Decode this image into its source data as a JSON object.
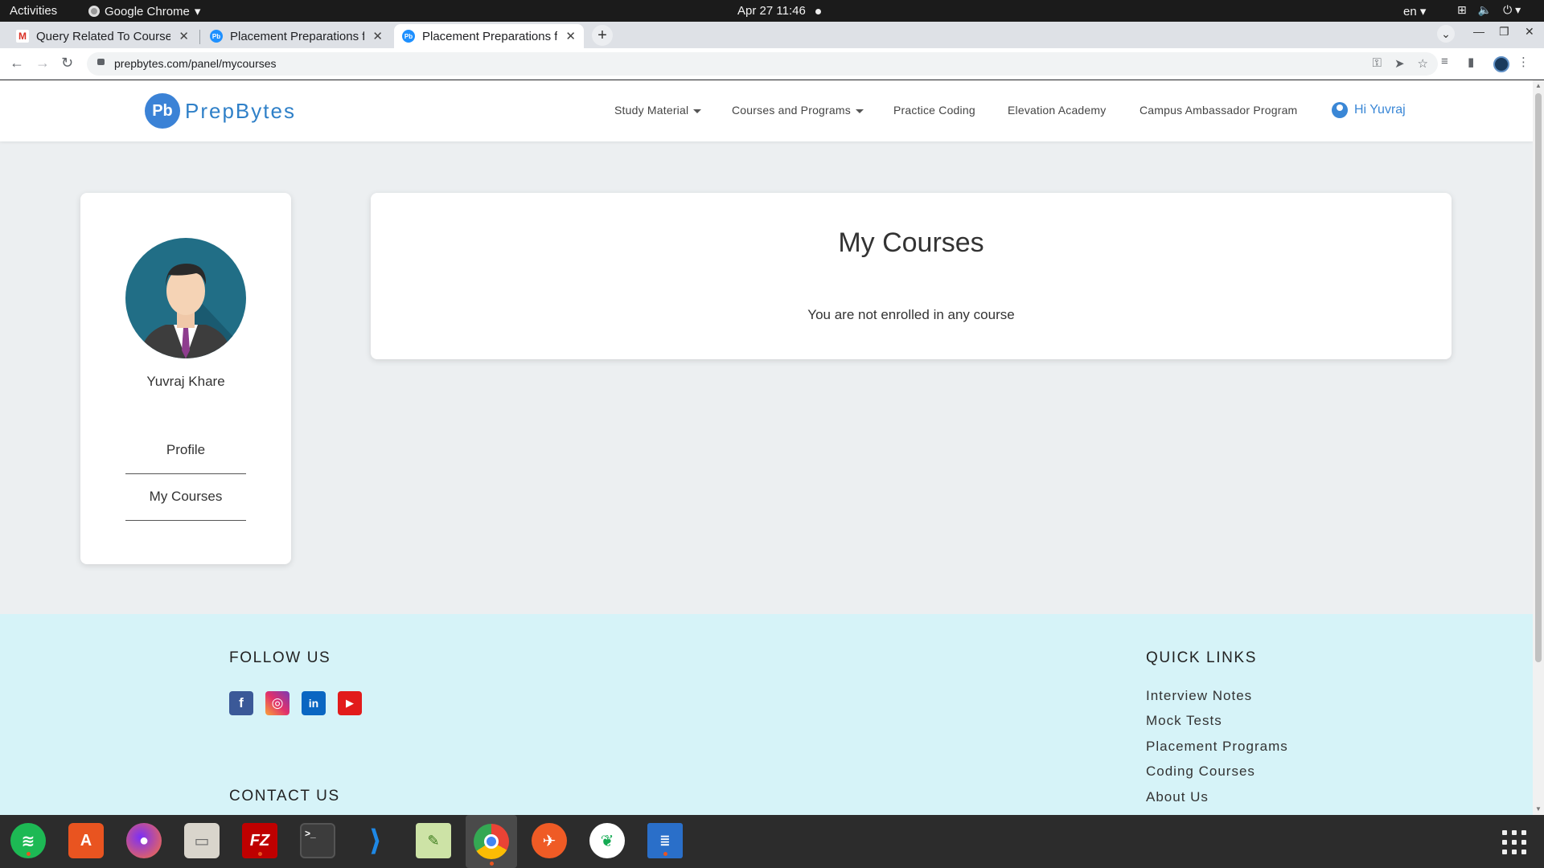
{
  "os": {
    "activities": "Activities",
    "app_name": "Google Chrome",
    "date": "Apr 27",
    "time": "11:46",
    "lang": "en"
  },
  "browser": {
    "tabs": [
      {
        "title": "Query Related To Course",
        "favicon": "gmail-icon",
        "active": false
      },
      {
        "title": "Placement Preparations f",
        "favicon": "prepbytes-icon",
        "active": false
      },
      {
        "title": "Placement Preparations f",
        "favicon": "prepbytes-icon",
        "active": true
      }
    ],
    "url": "prepbytes.com/panel/mycourses"
  },
  "site": {
    "logo_mark": "Pb",
    "logo_text": "PrepBytes",
    "nav": [
      {
        "label": "Study Material",
        "dropdown": true
      },
      {
        "label": "Courses and Programs",
        "dropdown": true
      },
      {
        "label": "Practice Coding",
        "dropdown": false
      },
      {
        "label": "Elevation Academy",
        "dropdown": false
      },
      {
        "label": "Campus Ambassador Program",
        "dropdown": false
      }
    ],
    "greeting": "Hi Yuvraj"
  },
  "sidebar": {
    "user_name": "Yuvraj Khare",
    "links": [
      "Profile",
      "My Courses"
    ]
  },
  "main": {
    "title": "My Courses",
    "message": "You are not enrolled in any course"
  },
  "footer": {
    "follow_heading": "FOLLOW US",
    "social": [
      "facebook-icon",
      "instagram-icon",
      "linkedin-icon",
      "youtube-icon"
    ],
    "contact_heading": "CONTACT US",
    "quick_heading": "QUICK LINKS",
    "quick_links": [
      "Interview Notes",
      "Mock Tests",
      "Placement Programs",
      "Coding Courses",
      "About Us"
    ]
  },
  "dock": [
    "spotify-icon",
    "software-center-icon",
    "firefox-icon",
    "files-icon",
    "filezilla-icon",
    "terminal-icon",
    "vscode-icon",
    "text-editor-icon",
    "chrome-icon",
    "postman-icon",
    "mongodb-compass-icon",
    "libreoffice-writer-icon"
  ],
  "colors": {
    "brand": "#3b82d6",
    "page_bg": "#eceff1",
    "footer_bg": "#d6f3f8",
    "chrome_tabstrip": "#dee1e6"
  }
}
